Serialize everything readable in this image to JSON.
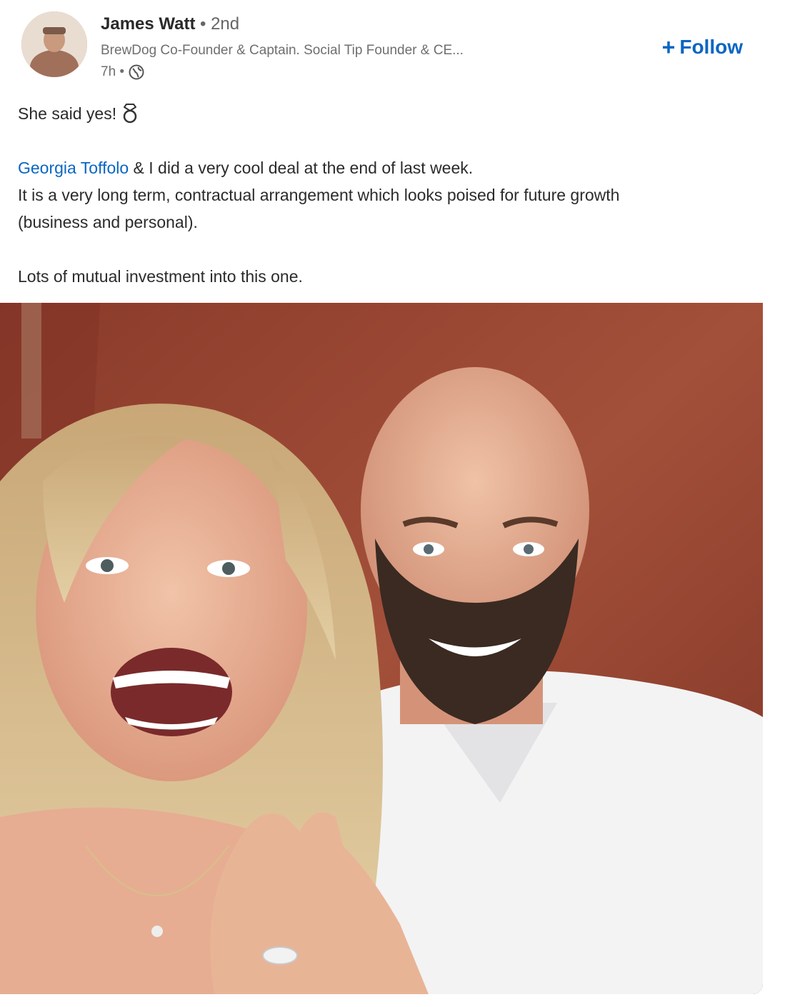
{
  "author": {
    "name": "James Watt",
    "degree": "• 2nd",
    "headline": "BrewDog Co-Founder & Captain. Social Tip Founder & CE...",
    "timestamp": "7h •",
    "visibility_icon": "globe-icon"
  },
  "follow": {
    "plus": "+",
    "label": "Follow"
  },
  "post": {
    "line1": "She said yes!",
    "ring_icon": "ring-icon",
    "mention": "Georgia Toffolo",
    "line2_rest": " & I did a very cool deal at the end of last week.",
    "line3": "It is a very long term, contractual arrangement which looks poised for future growth",
    "line4": "(business and personal).",
    "line5": "Lots of mutual investment into this one."
  },
  "colors": {
    "link": "#0a66c2",
    "text": "#2b2b2b",
    "muted": "#6f6f6f",
    "photo_background": "#8e3d2b"
  }
}
